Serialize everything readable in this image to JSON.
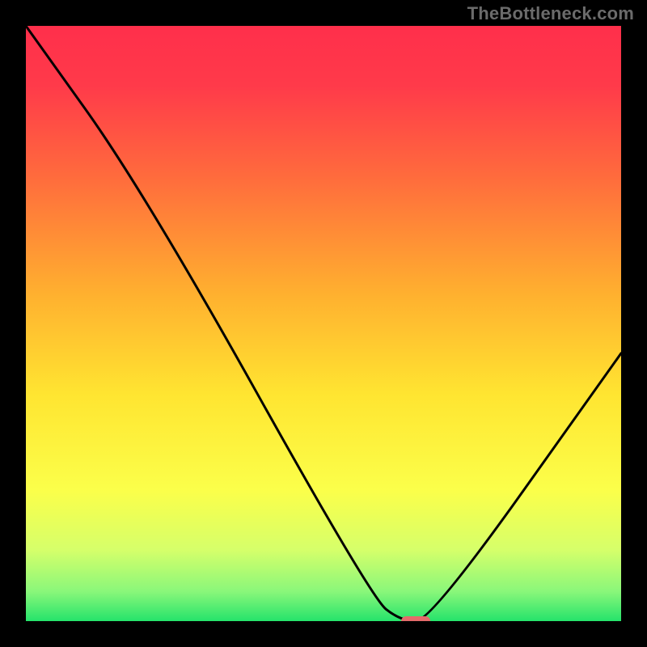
{
  "watermark": "TheBottleneck.com",
  "chart_data": {
    "type": "line",
    "title": "",
    "xlabel": "",
    "ylabel": "",
    "xlim": [
      0,
      100
    ],
    "ylim": [
      0,
      100
    ],
    "curve": [
      {
        "x": 0,
        "y": 100
      },
      {
        "x": 20,
        "y": 72
      },
      {
        "x": 58,
        "y": 4
      },
      {
        "x": 63,
        "y": 0
      },
      {
        "x": 68,
        "y": 0
      },
      {
        "x": 100,
        "y": 45
      }
    ],
    "marker": {
      "x": 65.5,
      "y": 0,
      "color": "#e46a6a"
    },
    "gradient_stops": [
      {
        "offset": 0.0,
        "color": "#ff2f4b"
      },
      {
        "offset": 0.1,
        "color": "#ff3a4a"
      },
      {
        "offset": 0.25,
        "color": "#ff6a3d"
      },
      {
        "offset": 0.45,
        "color": "#ffb02f"
      },
      {
        "offset": 0.62,
        "color": "#ffe531"
      },
      {
        "offset": 0.78,
        "color": "#fbff4a"
      },
      {
        "offset": 0.88,
        "color": "#d6ff6a"
      },
      {
        "offset": 0.95,
        "color": "#8af77a"
      },
      {
        "offset": 1.0,
        "color": "#25e36b"
      }
    ]
  }
}
